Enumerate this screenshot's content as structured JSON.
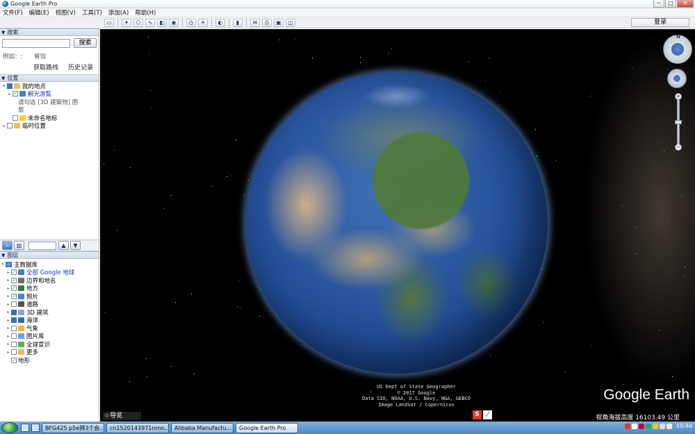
{
  "window": {
    "title": "Google Earth Pro",
    "minimize": "─",
    "maximize": "□",
    "close": "✕"
  },
  "menu": [
    "文件(F)",
    "编辑(E)",
    "视图(V)",
    "工具(T)",
    "添加(A)",
    "帮助(H)"
  ],
  "toolbar": {
    "login": "登录"
  },
  "search": {
    "header": "搜索",
    "placeholder": "",
    "button": "搜索",
    "example_label": "例如：:",
    "example_hint": "餐馆",
    "directions_link": "获取路线",
    "history_link": "历史记录"
  },
  "places": {
    "header": "位置",
    "items": [
      {
        "label": "我的地点",
        "depth": 0,
        "expander": "▸",
        "checked": "partial",
        "icon": "folder-icon"
      },
      {
        "label": "観光游覧",
        "depth": 1,
        "expander": "▸",
        "checked": true,
        "icon": "tour-icon",
        "link": true
      },
      {
        "label": "请勾选 [3D 建築物] 图",
        "depth": 2,
        "expander": "",
        "checked": null,
        "icon": "",
        "muted": true
      },
      {
        "label": "層",
        "depth": 2,
        "expander": "",
        "checked": null,
        "icon": "",
        "muted": true
      },
      {
        "label": "未命名地标",
        "depth": 1,
        "expander": "",
        "checked": false,
        "icon": "pushpin-icon"
      },
      {
        "label": "临时位置",
        "depth": 0,
        "expander": "▸",
        "checked": false,
        "icon": "folder-icon"
      }
    ]
  },
  "layers": {
    "header": "图层",
    "root": "主数据库",
    "items": [
      {
        "label": "全部 Google 地球",
        "checked": true,
        "icon": "globe-icon",
        "link": true
      },
      {
        "label": "边界和地名",
        "checked": true,
        "icon": "borders-icon"
      },
      {
        "label": "地方",
        "checked": true,
        "icon": "places-icon"
      },
      {
        "label": "照片",
        "checked": true,
        "icon": "photos-icon"
      },
      {
        "label": "道路",
        "checked": false,
        "icon": "roads-icon"
      },
      {
        "label": "3D 建筑",
        "checked": "partial",
        "icon": "buildings-icon"
      },
      {
        "label": "海洋",
        "checked": "partial",
        "icon": "ocean-icon"
      },
      {
        "label": "气象",
        "checked": false,
        "icon": "weather-icon"
      },
      {
        "label": "图片库",
        "checked": false,
        "icon": "gallery-icon"
      },
      {
        "label": "全球意识",
        "checked": false,
        "icon": "awareness-icon"
      },
      {
        "label": "更多",
        "checked": false,
        "icon": "more-icon"
      },
      {
        "label": "地形",
        "checked": true,
        "icon": ""
      }
    ]
  },
  "viewport": {
    "credits": [
      "US Dept of State Geographer",
      "© 2017 Google",
      "Data SIO, NOAA, U.S. Navy, NGA, GEBCO",
      "Image Landsat / Copernicus"
    ],
    "logo": "Google Earth",
    "nav_label": "导览",
    "nav_icon": "☆",
    "status": "视角海拔高度  16103.49 公里",
    "compass_n": "N"
  },
  "taskbar": {
    "tasks": [
      "BFG425 p5e狮3个会...",
      "cn1520143971nmo...",
      "Alibaba Manufactu...",
      "Google Earth Pro"
    ],
    "clock": "10:44"
  },
  "ime": {
    "s": "S",
    "t": "ノ"
  }
}
